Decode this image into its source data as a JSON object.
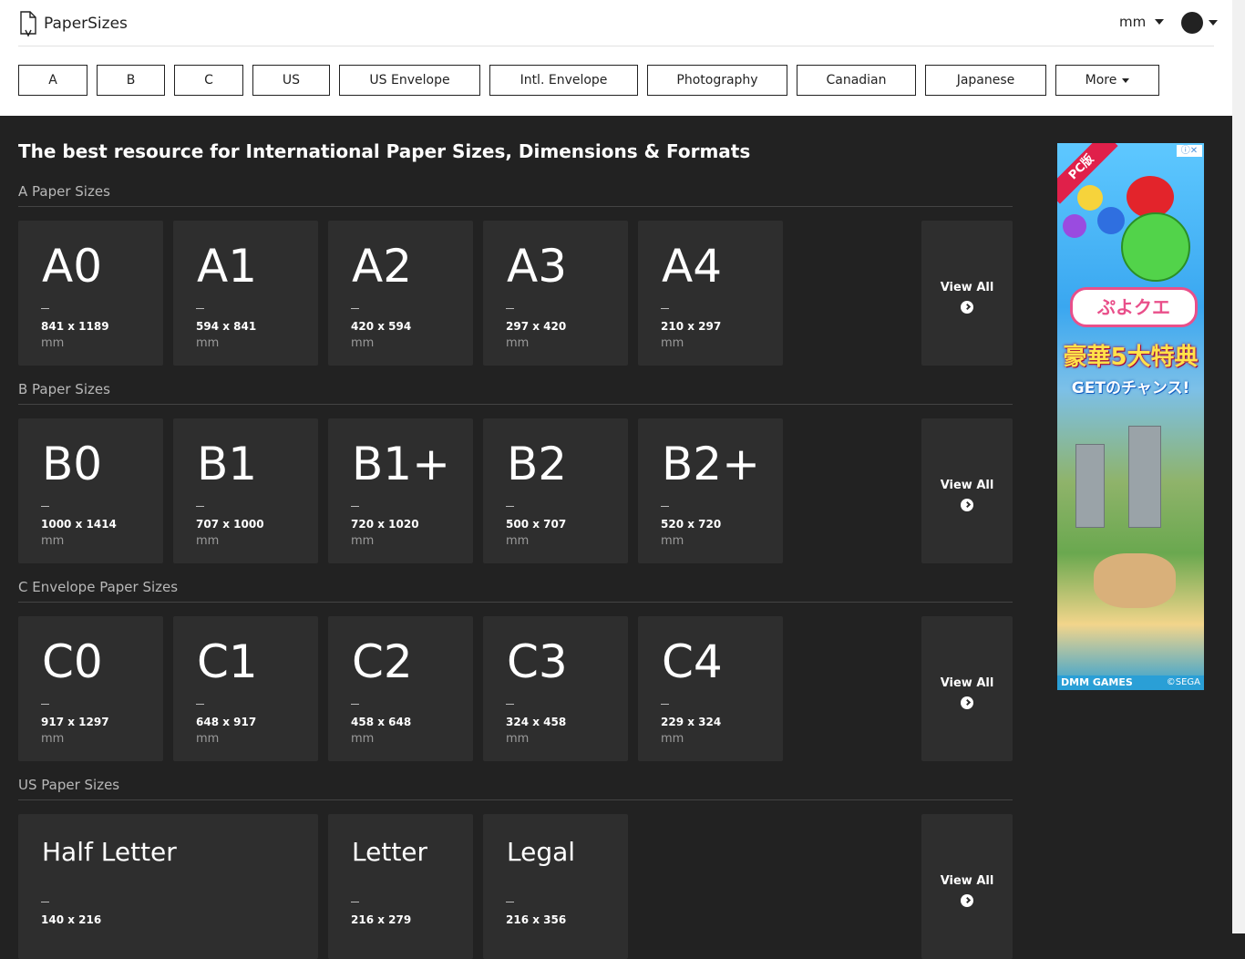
{
  "header": {
    "brand": "PaperSizes",
    "unit": "mm",
    "nav": [
      "A",
      "B",
      "C",
      "US",
      "US Envelope",
      "Intl. Envelope",
      "Photography",
      "Canadian",
      "Japanese",
      "More"
    ]
  },
  "hero": "The best resource for International Paper Sizes, Dimensions & Formats",
  "sections": [
    {
      "title": "A Paper Sizes",
      "cards": [
        {
          "name": "A0",
          "dims": "841 x 1189",
          "unit": "mm"
        },
        {
          "name": "A1",
          "dims": "594 x 841",
          "unit": "mm"
        },
        {
          "name": "A2",
          "dims": "420 x 594",
          "unit": "mm"
        },
        {
          "name": "A3",
          "dims": "297 x 420",
          "unit": "mm"
        },
        {
          "name": "A4",
          "dims": "210 x 297",
          "unit": "mm"
        }
      ],
      "view_all": "View All"
    },
    {
      "title": "B Paper Sizes",
      "cards": [
        {
          "name": "B0",
          "dims": "1000 x 1414",
          "unit": "mm"
        },
        {
          "name": "B1",
          "dims": "707 x 1000",
          "unit": "mm"
        },
        {
          "name": "B1+",
          "dims": "720 x 1020",
          "unit": "mm"
        },
        {
          "name": "B2",
          "dims": "500 x 707",
          "unit": "mm"
        },
        {
          "name": "B2+",
          "dims": "520 x 720",
          "unit": "mm"
        }
      ],
      "view_all": "View All"
    },
    {
      "title": "C Envelope Paper Sizes",
      "cards": [
        {
          "name": "C0",
          "dims": "917 x 1297",
          "unit": "mm"
        },
        {
          "name": "C1",
          "dims": "648 x 917",
          "unit": "mm"
        },
        {
          "name": "C2",
          "dims": "458 x 648",
          "unit": "mm"
        },
        {
          "name": "C3",
          "dims": "324 x 458",
          "unit": "mm"
        },
        {
          "name": "C4",
          "dims": "229 x 324",
          "unit": "mm"
        }
      ],
      "view_all": "View All"
    },
    {
      "title": "US Paper Sizes",
      "cards": [
        {
          "name": "Half Letter",
          "dims": "140 x 216"
        },
        {
          "name": "Letter",
          "dims": "216 x 279"
        },
        {
          "name": "Legal",
          "dims": "216 x 356"
        }
      ],
      "view_all": "View All"
    }
  ],
  "ad": {
    "ribbon": "PC版",
    "close": "ⓘ✕",
    "logo": "ぷよクエ",
    "headline": "豪華5大特典",
    "sub": "GETのチャンス!",
    "footer_left": "DMM GAMES",
    "footer_right": "©SEGA"
  },
  "colors": {
    "page_bg": "#222222",
    "card_bg": "#2e2e2e",
    "header_bg": "#ffffff"
  }
}
